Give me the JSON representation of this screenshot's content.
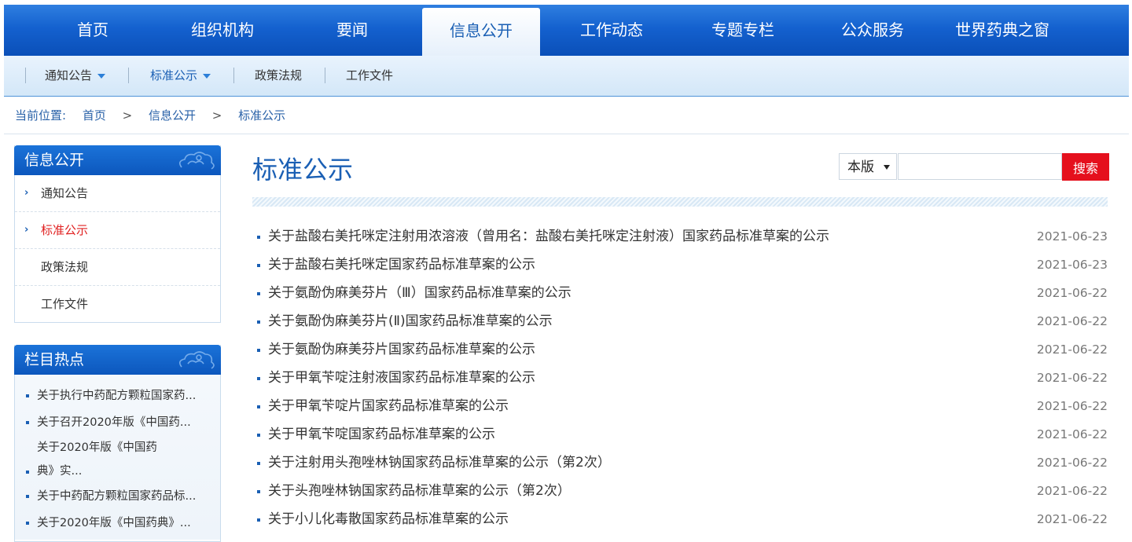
{
  "topnav": {
    "items": [
      {
        "label": "首页"
      },
      {
        "label": "组织机构"
      },
      {
        "label": "要闻"
      },
      {
        "label": "信息公开"
      },
      {
        "label": "工作动态"
      },
      {
        "label": "专题专栏"
      },
      {
        "label": "公众服务"
      },
      {
        "label": "世界药典之窗"
      }
    ],
    "active": "信息公开"
  },
  "subnav": {
    "items": [
      {
        "label": "通知公告"
      },
      {
        "label": "标准公示"
      },
      {
        "label": "政策法规"
      },
      {
        "label": "工作文件"
      }
    ],
    "active": "标准公示"
  },
  "breadcrumb": {
    "prefix": "当前位置:",
    "items": [
      "首页",
      "信息公开",
      "标准公示"
    ],
    "separator": ">"
  },
  "sidebar": {
    "section_title": "信息公开",
    "items": [
      {
        "label": "通知公告"
      },
      {
        "label": "标准公示"
      },
      {
        "label": "政策法规"
      },
      {
        "label": "工作文件"
      }
    ],
    "hot_title": "栏目热点",
    "hot_items": [
      "关于执行中药配方颗粒国家药...",
      "关于召开2020年版《中国药...",
      "关于2020年版《中国药典》实...",
      "关于中药配方颗粒国家药品标...",
      "关于2020年版《中国药典》..."
    ]
  },
  "main": {
    "title": "标准公示",
    "search": {
      "scope": "本版",
      "placeholder": "",
      "button": "搜索"
    },
    "articles": [
      {
        "title": "关于盐酸右美托咪定注射用浓溶液（曾用名：盐酸右美托咪定注射液）国家药品标准草案的公示",
        "date": "2021-06-23"
      },
      {
        "title": "关于盐酸右美托咪定国家药品标准草案的公示",
        "date": "2021-06-23"
      },
      {
        "title": "关于氨酚伪麻美芬片（Ⅲ）国家药品标准草案的公示",
        "date": "2021-06-22"
      },
      {
        "title": "关于氨酚伪麻美芬片(Ⅱ)国家药品标准草案的公示",
        "date": "2021-06-22"
      },
      {
        "title": "关于氨酚伪麻美芬片国家药品标准草案的公示",
        "date": "2021-06-22"
      },
      {
        "title": "关于甲氧苄啶注射液国家药品标准草案的公示",
        "date": "2021-06-22"
      },
      {
        "title": "关于甲氧苄啶片国家药品标准草案的公示",
        "date": "2021-06-22"
      },
      {
        "title": "关于甲氧苄啶国家药品标准草案的公示",
        "date": "2021-06-22"
      },
      {
        "title": "关于注射用头孢唑林钠国家药品标准草案的公示（第2次）",
        "date": "2021-06-22"
      },
      {
        "title": "关于头孢唑林钠国家药品标准草案的公示（第2次）",
        "date": "2021-06-22"
      },
      {
        "title": "关于小儿化毒散国家药品标准草案的公示",
        "date": "2021-06-22"
      }
    ]
  },
  "colors": {
    "nav_blue": "#1461cf",
    "link_blue": "#1a5fb4",
    "active_red": "#e02020",
    "search_button": "#e5101d"
  }
}
